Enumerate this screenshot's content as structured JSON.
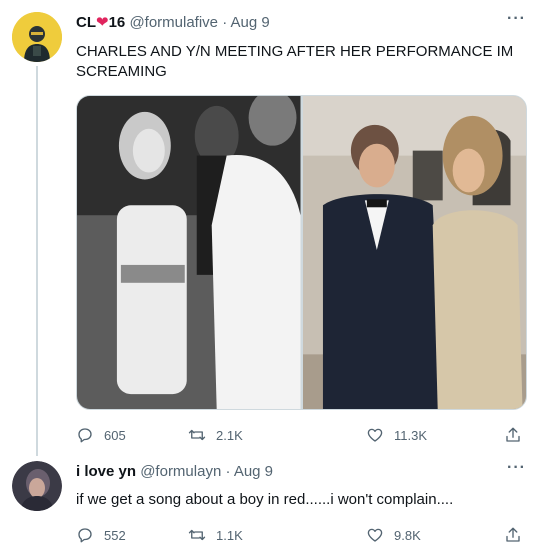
{
  "tweets": [
    {
      "display_name": "CL",
      "name_suffix": "16",
      "handle": "@formulafive",
      "separator": "·",
      "date": "Aug 9",
      "more": "···",
      "text": "CHARLES AND Y/N MEETING AFTER HER PERFORMANCE IM SCREAMING",
      "replies": "605",
      "retweets": "2.1K",
      "likes": "11.3K"
    },
    {
      "display_name": "i love yn",
      "handle": "@formulayn",
      "separator": "·",
      "date": "Aug 9",
      "more": "···",
      "text": "if we get a song about a boy in red......i won't complain....",
      "replies": "552",
      "retweets": "1.1K",
      "likes": "9.8K"
    }
  ],
  "icons": {
    "reply": "reply-icon",
    "retweet": "retweet-icon",
    "like": "heart-icon",
    "share": "share-icon",
    "name_emoji": "red-heart-emoji-icon"
  },
  "colors": {
    "text": "#0f1419",
    "meta": "#536471",
    "thread_line": "#cfd9de",
    "heart_emoji": "#e0245e"
  }
}
